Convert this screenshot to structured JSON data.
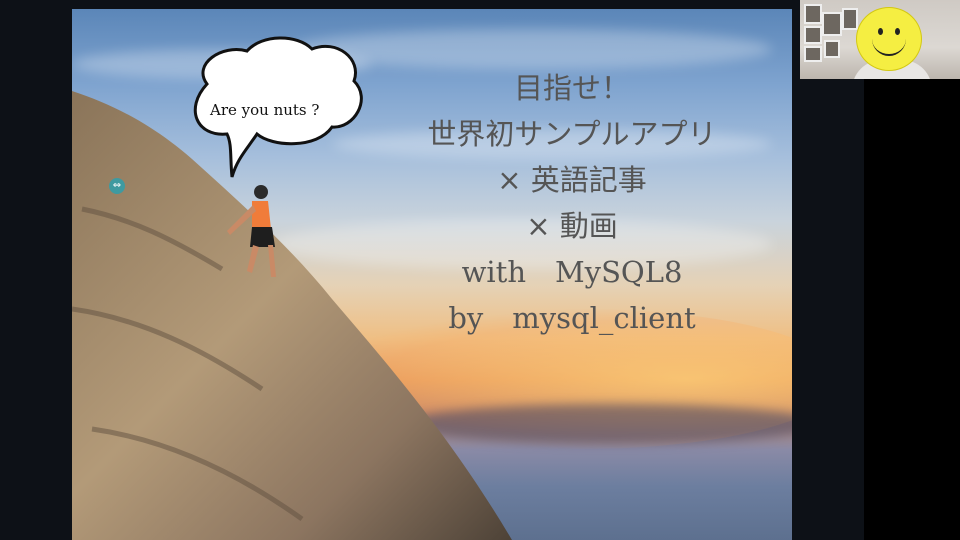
{
  "slide": {
    "title_lines": [
      "目指せ！",
      "世界初サンプルアプリ",
      "× 英語記事",
      "× 動画",
      "with　MySQL8",
      "by　mysql_client"
    ],
    "speech_bubble": "Are you nuts ?"
  },
  "icons": {
    "nav_dot": "arrow-left-right-icon",
    "avatar": "smiley-face-icon"
  },
  "colors": {
    "title_text": "#555555",
    "smiley_face": "#f5ee42"
  }
}
